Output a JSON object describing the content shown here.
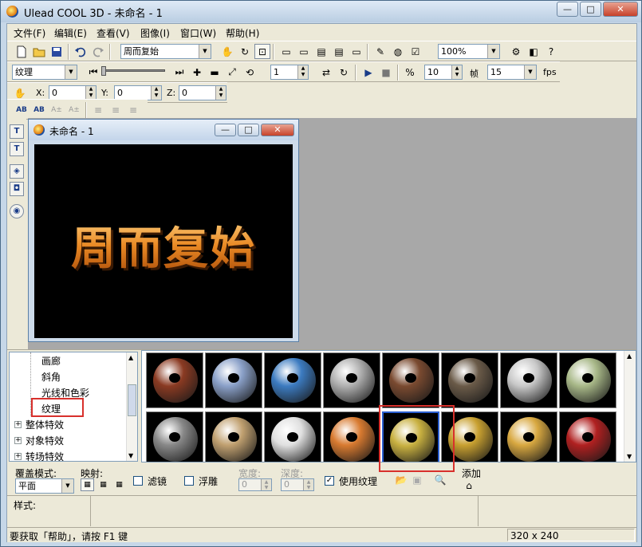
{
  "window": {
    "title": "Ulead COOL 3D - 未命名 - 1",
    "min_label": "—",
    "max_label": "□",
    "close_label": "✕"
  },
  "menu": [
    "文件(F)",
    "编辑(E)",
    "查看(V)",
    "图像(I)",
    "窗口(W)",
    "帮助(H)"
  ],
  "toolbar1": {
    "text_object_select": "周而复始",
    "zoom": "100%"
  },
  "toolbar2": {
    "attribute_select": "纹理",
    "frame_value": "1",
    "frames_total": "10",
    "frames_label": "帧",
    "fps_value": "15",
    "fps_label": "fps"
  },
  "toolbar3": {
    "x_label": "X:",
    "x_value": "0",
    "y_label": "Y:",
    "y_value": "0",
    "z_label": "Z:",
    "z_value": "0"
  },
  "toolbar4": {
    "ab1": "AB",
    "ab2": "AB",
    "ab3": "A±",
    "ab4": "A±"
  },
  "document": {
    "title": "未命名 - 1",
    "canvas_text": "周而复始"
  },
  "tree": {
    "items": [
      "画廊",
      "斜角",
      "光线和色彩",
      "纹理",
      "整体特效",
      "对象特效",
      "转场特效"
    ],
    "selected": "纹理"
  },
  "gallery": {
    "thumbnails": [
      {
        "name": "brick",
        "color": "#8a3a22"
      },
      {
        "name": "blue-silver",
        "color": "#8aa0c8"
      },
      {
        "name": "water-blue",
        "color": "#3c7bc0"
      },
      {
        "name": "stone-wall",
        "color": "#b0b0b0"
      },
      {
        "name": "wood-bark",
        "color": "#7a4a30"
      },
      {
        "name": "rock",
        "color": "#6a5a48"
      },
      {
        "name": "silver-grain",
        "color": "#c8c8c8"
      },
      {
        "name": "green-marble",
        "color": "#a8b888"
      },
      {
        "name": "granite",
        "color": "#888888"
      },
      {
        "name": "sand",
        "color": "#c0a070"
      },
      {
        "name": "chrome",
        "color": "#e0e0e0"
      },
      {
        "name": "copper",
        "color": "#d87a30"
      },
      {
        "name": "gold-disc",
        "color": "#c8b040"
      },
      {
        "name": "gold",
        "color": "#c8a030"
      },
      {
        "name": "gold-bright",
        "color": "#d8a840"
      },
      {
        "name": "red-brick",
        "color": "#b02020"
      }
    ],
    "selected_index": 12
  },
  "options": {
    "cover_mode_label": "覆盖模式:",
    "cover_mode_value": "平面",
    "mapping_label": "映射:",
    "filter_label": "滤镜",
    "relief_label": "浮雕",
    "width_label": "宽度:",
    "width_value": "0",
    "depth_label": "深度:",
    "depth_value": "0",
    "use_texture_label": "使用纹理",
    "use_texture_checked": true,
    "add_label": "添加"
  },
  "style_row": {
    "label": "样式:"
  },
  "status": {
    "help_text": "要获取「帮助」，请按 F1 键",
    "size": "320 x 240"
  },
  "colors": {
    "highlight_red": "#d8302c",
    "selection_blue": "#2a5fd0"
  }
}
